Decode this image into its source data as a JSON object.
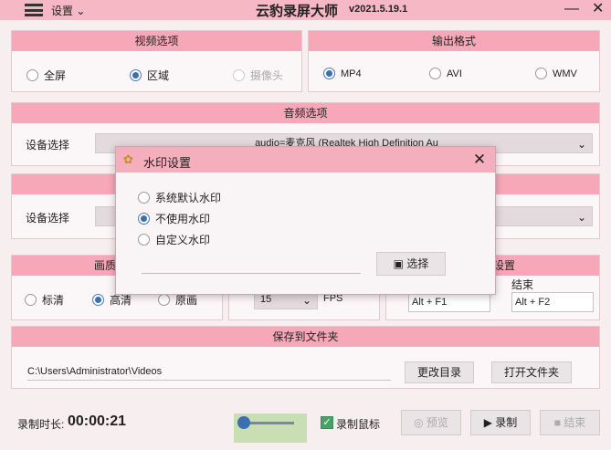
{
  "titlebar": {
    "settings_label": "设置",
    "title": "云豹录屏大师",
    "version": "v2021.5.19.1",
    "minimize": "—",
    "close": "✕"
  },
  "video": {
    "header": "视频选项",
    "options": [
      "全屏",
      "区域",
      "摄像头"
    ],
    "selected": "区域"
  },
  "output": {
    "header": "输出格式",
    "options": [
      "MP4",
      "AVI",
      "WMV"
    ],
    "selected": "MP4"
  },
  "audio": {
    "header": "音频选项",
    "device_label": "设备选择",
    "device_value": "audio=麦克风 (Realtek High Definition Au"
  },
  "camera": {
    "device_label": "设备选择"
  },
  "quality": {
    "header_partial": "画质",
    "options": [
      "标清",
      "高清",
      "原画"
    ],
    "selected": "高清",
    "fps_value": "15",
    "fps_label": "FPS"
  },
  "hotkeys": {
    "header_partial": "设置",
    "end_label": "结束",
    "start_value": "Alt + F1",
    "end_value": "Alt + F2"
  },
  "save": {
    "header": "保存到文件夹",
    "path": "C:\\Users\\Administrator\\Videos",
    "change_button": "更改目录",
    "open_button": "打开文件夹"
  },
  "bottom": {
    "duration_label": "录制时长:",
    "duration_value": "00:00:21",
    "record_mouse_label": "录制鼠标",
    "preview_button": "预览",
    "record_button": "录制",
    "stop_button": "结束"
  },
  "watermark_dialog": {
    "title": "水印设置",
    "options": [
      "系统默认水印",
      "不使用水印",
      "自定义水印"
    ],
    "selected": "不使用水印",
    "select_button": "选择",
    "close": "✕"
  },
  "colors": {
    "accent_pink": "#f7a8b8",
    "titlebar": "#f6b8c4",
    "radio_selected": "#3a6fb0"
  }
}
